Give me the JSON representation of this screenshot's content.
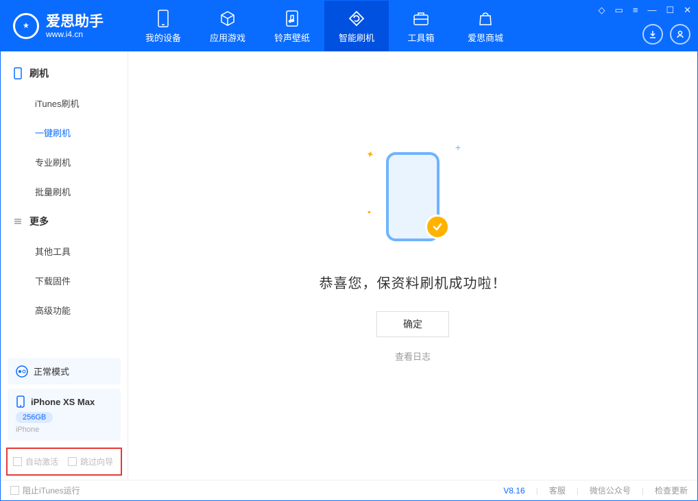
{
  "app": {
    "name": "爱思助手",
    "url": "www.i4.cn"
  },
  "nav": {
    "tabs": [
      {
        "label": "我的设备",
        "icon": "device"
      },
      {
        "label": "应用游戏",
        "icon": "cube"
      },
      {
        "label": "铃声壁纸",
        "icon": "music"
      },
      {
        "label": "智能刷机",
        "icon": "refresh",
        "active": true
      },
      {
        "label": "工具箱",
        "icon": "toolbox"
      },
      {
        "label": "爱思商城",
        "icon": "bag"
      }
    ]
  },
  "sidebar": {
    "sections": [
      {
        "title": "刷机",
        "items": [
          {
            "label": "iTunes刷机"
          },
          {
            "label": "一键刷机",
            "active": true
          },
          {
            "label": "专业刷机"
          },
          {
            "label": "批量刷机"
          }
        ]
      },
      {
        "title": "更多",
        "items": [
          {
            "label": "其他工具"
          },
          {
            "label": "下载固件"
          },
          {
            "label": "高级功能"
          }
        ]
      }
    ],
    "mode": "正常模式",
    "device": {
      "name": "iPhone XS Max",
      "storage": "256GB",
      "type": "iPhone"
    },
    "checkboxes": [
      {
        "label": "自动激活"
      },
      {
        "label": "跳过向导"
      }
    ]
  },
  "main": {
    "success_text": "恭喜您，保资料刷机成功啦！",
    "ok_button": "确定",
    "log_link": "查看日志"
  },
  "footer": {
    "block_itunes": "阻止iTunes运行",
    "version": "V8.16",
    "links": [
      "客服",
      "微信公众号",
      "检查更新"
    ]
  }
}
